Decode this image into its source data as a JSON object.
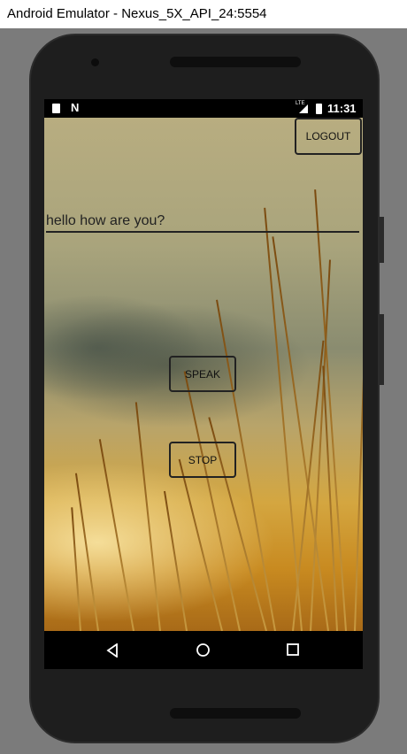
{
  "window": {
    "title": "Android Emulator - Nexus_5X_API_24:5554"
  },
  "status_bar": {
    "time": "11:31",
    "network": "LTE"
  },
  "app": {
    "logout_label": "LOGOUT",
    "text_input_value": "hello how are you?",
    "speak_label": "SPEAK",
    "stop_label": "STOP"
  },
  "nav": {
    "back": "back-icon",
    "home": "home-icon",
    "recents": "recents-icon"
  }
}
